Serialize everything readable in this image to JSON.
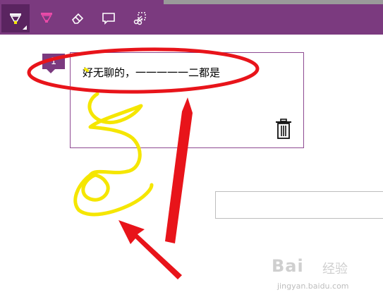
{
  "toolbar": {
    "accent": "#7b3a7f",
    "tools": [
      {
        "icon": "pen-icon",
        "active": true
      },
      {
        "icon": "highlighter-icon",
        "active": false
      },
      {
        "icon": "eraser-icon",
        "active": false
      },
      {
        "icon": "comment-icon",
        "active": false
      },
      {
        "icon": "clip-icon",
        "active": false
      }
    ]
  },
  "note": {
    "number": "1",
    "text": "好无聊的，一一一一一二都是"
  },
  "watermark": {
    "brand": "Bai",
    "brand2": "经验",
    "url": "jingyan.baidu.com"
  },
  "annotations": {
    "ellipse_color": "#e8141a",
    "ink_color": "#f5e600"
  }
}
